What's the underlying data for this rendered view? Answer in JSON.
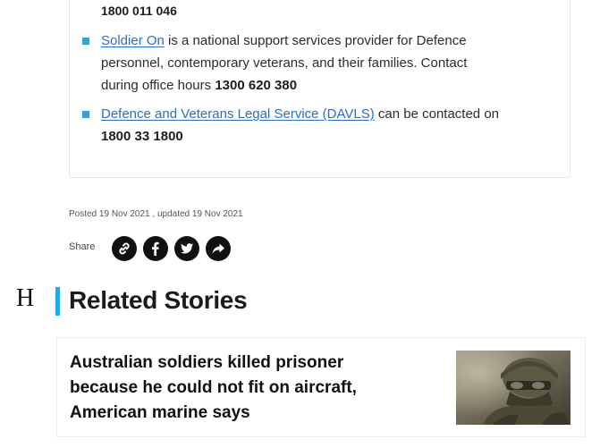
{
  "contacts": {
    "top_phone": "1800 011 046",
    "items": [
      {
        "link": "Soldier On",
        "line1_rest": " is a national support services provider for Defence",
        "line2": "personnel, contemporary veterans, and their families. Contact",
        "line3_prefix": "during office hours ",
        "phone": "1300 620 380"
      },
      {
        "link": "Defence and Veterans Legal Service (DAVLS)",
        "line1_rest": " can be contacted on",
        "phone": "1800 33 1800"
      }
    ]
  },
  "meta": {
    "posted": "Posted 19 Nov 2021 , updated 19 Nov 2021"
  },
  "share": {
    "label": "Share",
    "icons": [
      "link-icon",
      "facebook-icon",
      "twitter-icon",
      "share-arrow-icon"
    ]
  },
  "related": {
    "stray_letter": "H",
    "title": "Related Stories",
    "stories": [
      {
        "line1": "Australian soldiers killed prisoner",
        "line2": "because he could not fit on aircraft,",
        "line3": "American marine says",
        "image_icon": "soldier-photo"
      }
    ]
  },
  "colors": {
    "accent": "#1fa9e6",
    "link": "#2a6fc4"
  }
}
